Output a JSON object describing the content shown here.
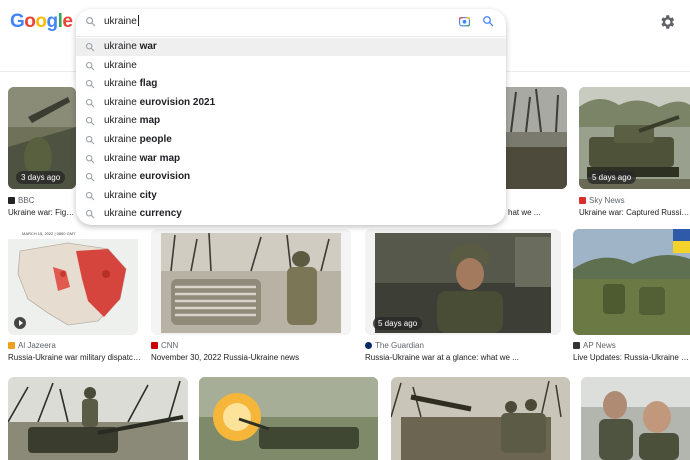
{
  "header": {
    "logo_letters": [
      {
        "ch": "G",
        "color": "#4285F4"
      },
      {
        "ch": "o",
        "color": "#EA4335"
      },
      {
        "ch": "o",
        "color": "#FBBC05"
      },
      {
        "ch": "g",
        "color": "#4285F4"
      },
      {
        "ch": "l",
        "color": "#34A853"
      },
      {
        "ch": "e",
        "color": "#EA4335"
      }
    ],
    "settings_icon": "gear-icon"
  },
  "search": {
    "query": "ukraine",
    "icons": [
      "search-icon",
      "camera-icon",
      "search-submit-icon"
    ],
    "suggestions": [
      {
        "base": "ukraine",
        "completion": "war"
      },
      {
        "base": "ukraine",
        "completion": ""
      },
      {
        "base": "ukraine",
        "completion": "flag"
      },
      {
        "base": "ukraine",
        "completion": "eurovision 2021"
      },
      {
        "base": "ukraine",
        "completion": "map"
      },
      {
        "base": "ukraine",
        "completion": "people"
      },
      {
        "base": "ukraine",
        "completion": "war map"
      },
      {
        "base": "ukraine",
        "completion": "eurovision"
      },
      {
        "base": "ukraine",
        "completion": "city"
      },
      {
        "base": "ukraine",
        "completion": "currency"
      }
    ]
  },
  "results": {
    "row1": [
      {
        "age": "3 days ago",
        "source": "BBC",
        "caption": "Ukraine war: Fighting",
        "fav_color": "#222222"
      },
      {
        "age": "",
        "source": "",
        "caption": "hat we ...",
        "fav_color": "#ffffff"
      },
      {
        "age": "5 days ago",
        "source": "Sky News",
        "caption": "Ukraine war: Captured Russian do",
        "fav_color": "#d92d2d"
      }
    ],
    "row2": [
      {
        "age": "",
        "source": "Al Jazeera",
        "caption": "Russia-Ukraine war military dispatch...",
        "fav_color": "#f0a020",
        "map_header": "MARCH 15, 2022 | 0800 GMT"
      },
      {
        "age": "",
        "source": "CNN",
        "caption": "November 30, 2022 Russia-Ukraine news",
        "fav_color": "#cc0000"
      },
      {
        "age": "5 days ago",
        "source": "The Guardian",
        "caption": "Russia-Ukraine war at a glance: what we ...",
        "fav_color": "#052962"
      },
      {
        "age": "",
        "source": "AP News",
        "caption": "Live Updates: Russia-Ukraine War | A",
        "fav_color": "#333333"
      }
    ]
  }
}
